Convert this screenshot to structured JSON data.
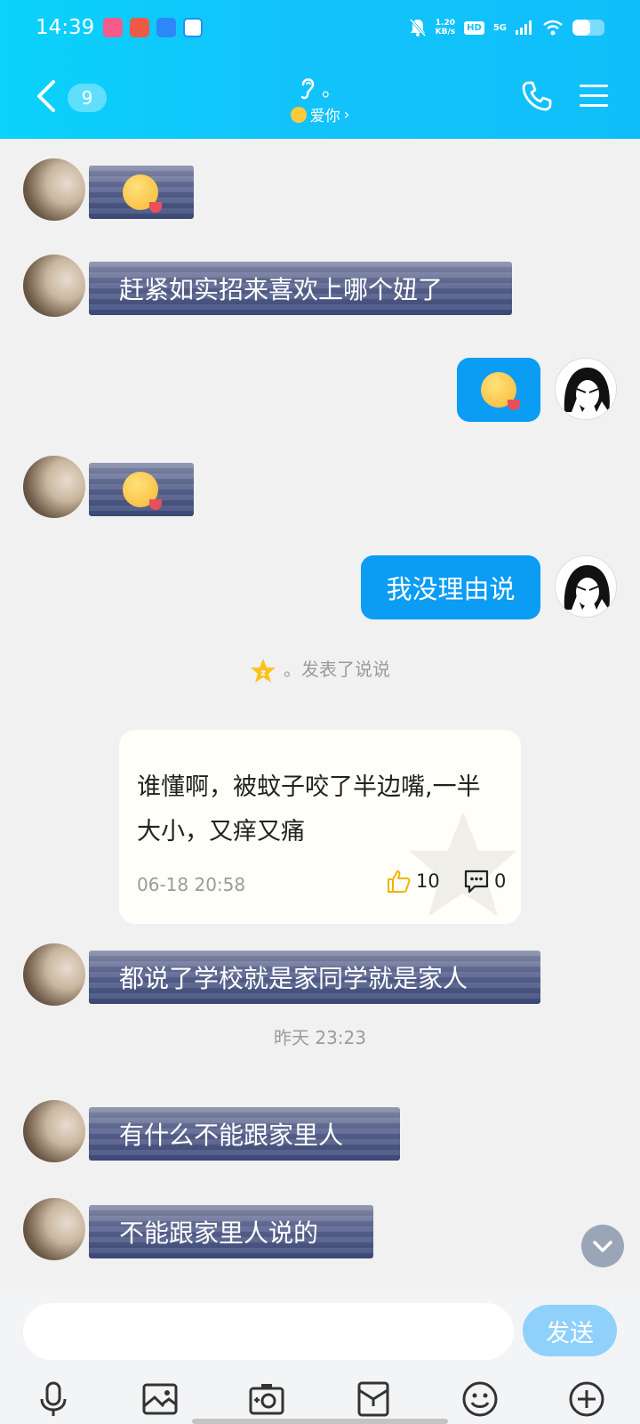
{
  "status_bar": {
    "time": "14:39",
    "net_speed": "1.20",
    "net_unit": "KB/s",
    "hd": "HD",
    "signal": "5G",
    "battery_level": 0.55
  },
  "header": {
    "unread_count": "9",
    "contact_name": "。",
    "contact_status": "爱你",
    "status_chevron": "›",
    "accent": "#10c3fa"
  },
  "messages": [
    {
      "side": "left",
      "type": "emoji",
      "text": ""
    },
    {
      "side": "left",
      "type": "text",
      "text": "赶紧如实招来喜欢上哪个妞了"
    },
    {
      "side": "right",
      "type": "emoji",
      "text": ""
    },
    {
      "side": "left",
      "type": "emoji",
      "text": ""
    },
    {
      "side": "right",
      "type": "text",
      "text": "我没理由说"
    }
  ],
  "post_notice": "。发表了说说",
  "post": {
    "text": "谁懂啊，被蚊子咬了半边嘴,一半大小，又痒又痛",
    "date": "06-18 20:58",
    "likes": "10",
    "comments": "0"
  },
  "messages2": [
    {
      "side": "left",
      "type": "text",
      "text": "都说了学校就是家同学就是家人"
    }
  ],
  "timestamp": "昨天 23:23",
  "messages3": [
    {
      "side": "left",
      "type": "text",
      "text": "有什么不能跟家里人"
    },
    {
      "side": "left",
      "type": "text",
      "text": "不能跟家里人说的"
    }
  ],
  "input": {
    "value": "",
    "placeholder": "",
    "send_label": "发送"
  },
  "toolbar_icons": [
    "microphone-icon",
    "image-icon",
    "camera-icon",
    "red-packet-icon",
    "emoji-icon",
    "plus-icon"
  ],
  "colors": {
    "self_bubble": "#0b9cf3",
    "other_bubble": "#4a5682",
    "send_button": "#8fd1fb"
  }
}
